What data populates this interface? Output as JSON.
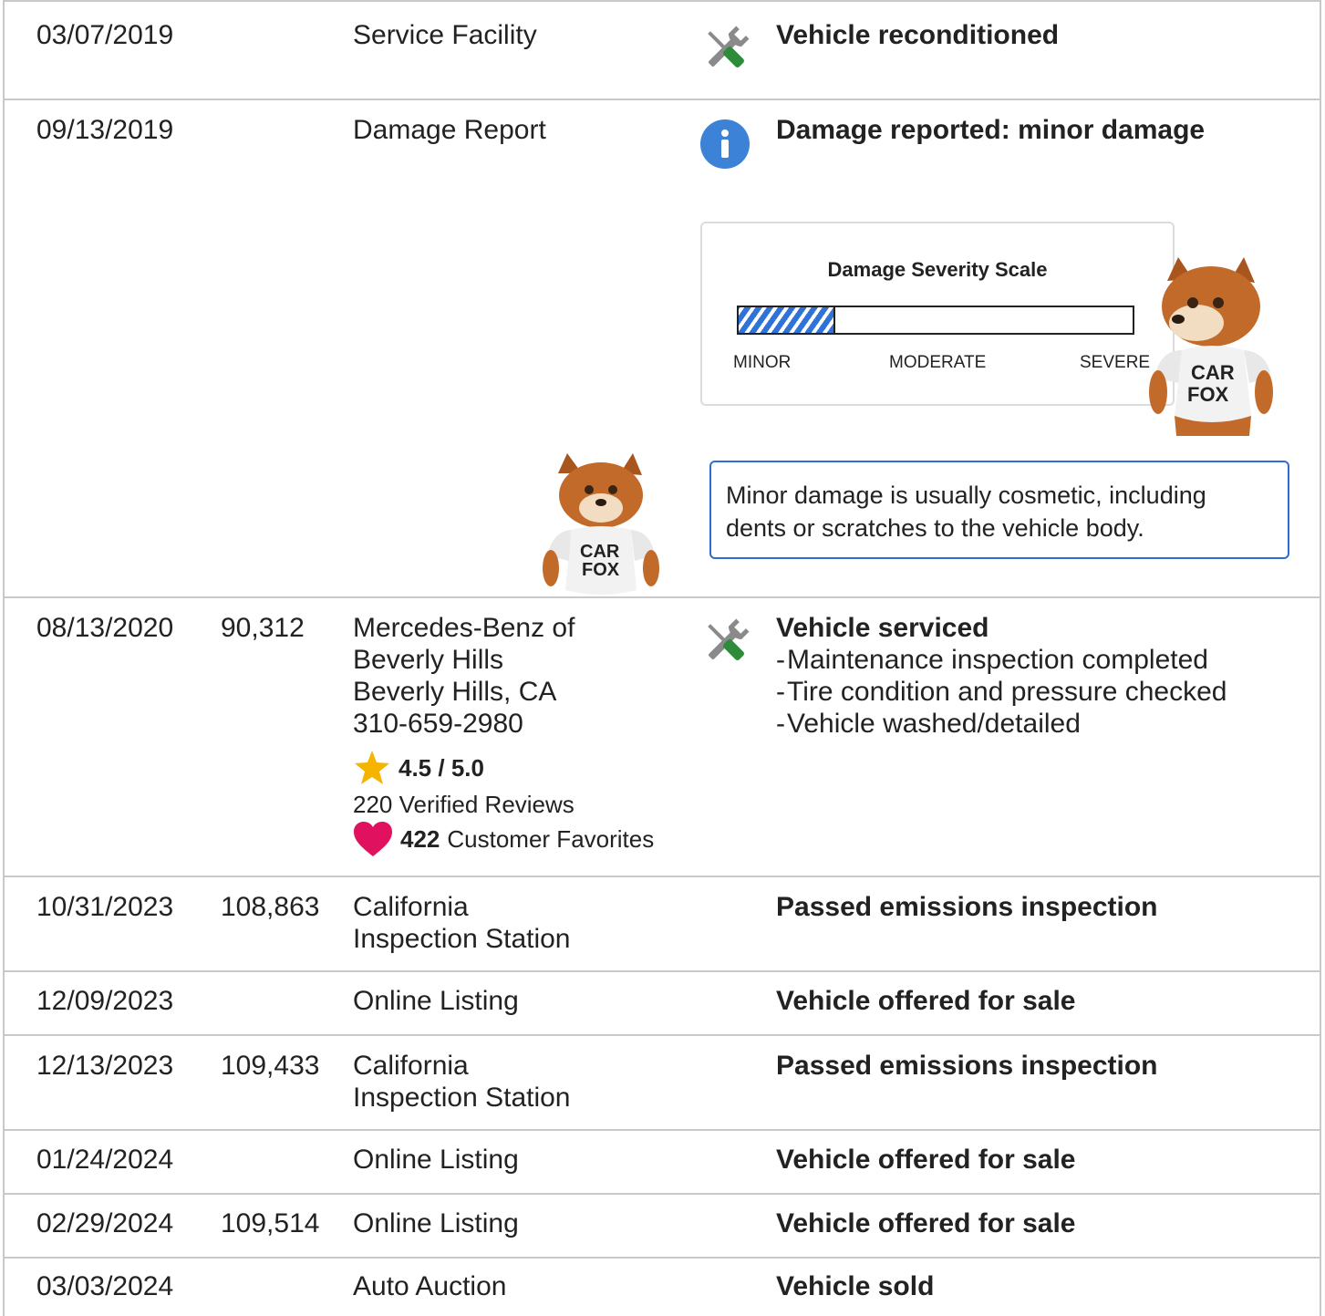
{
  "records": [
    {
      "date": "03/07/2019",
      "odometer": "",
      "source": [
        "Service Facility"
      ],
      "icon": "wrench-screwdriver-icon",
      "title": "Vehicle reconditioned",
      "details": []
    },
    {
      "date": "09/13/2019",
      "odometer": "",
      "source": [
        "Damage Report"
      ],
      "icon": "info-icon",
      "title": "Damage reported: minor damage",
      "details": []
    },
    {
      "date": "08/13/2020",
      "odometer": "90,312",
      "source": [
        "Mercedes-Benz of",
        "Beverly Hills",
        "Beverly Hills, CA",
        "310-659-2980"
      ],
      "icon": "wrench-screwdriver-icon",
      "title": "Vehicle serviced",
      "details": [
        "Maintenance inspection completed",
        "Tire condition and pressure checked",
        "Vehicle washed/detailed"
      ]
    },
    {
      "date": "10/31/2023",
      "odometer": "108,863",
      "source": [
        "California",
        "Inspection Station"
      ],
      "icon": "",
      "title": "Passed emissions inspection",
      "details": []
    },
    {
      "date": "12/09/2023",
      "odometer": "",
      "source": [
        "Online Listing"
      ],
      "icon": "",
      "title": "Vehicle offered for sale",
      "details": []
    },
    {
      "date": "12/13/2023",
      "odometer": "109,433",
      "source": [
        "California",
        "Inspection Station"
      ],
      "icon": "",
      "title": "Passed emissions inspection",
      "details": []
    },
    {
      "date": "01/24/2024",
      "odometer": "",
      "source": [
        "Online Listing"
      ],
      "icon": "",
      "title": "Vehicle offered for sale",
      "details": []
    },
    {
      "date": "02/29/2024",
      "odometer": "109,514",
      "source": [
        "Online Listing"
      ],
      "icon": "",
      "title": "Vehicle offered for sale",
      "details": []
    },
    {
      "date": "03/03/2024",
      "odometer": "",
      "source": [
        "Auto Auction"
      ],
      "icon": "",
      "title": "Vehicle sold",
      "details": []
    }
  ],
  "damage_scale": {
    "title": "Damage Severity Scale",
    "labels": [
      "MINOR",
      "MODERATE",
      "SEVERE"
    ],
    "level_fraction": 0.24,
    "fill_color": "#2f72d8",
    "note": "Minor damage is usually cosmetic, including dents or scratches to the vehicle body."
  },
  "dealer_rating": {
    "score": "4.5 / 5.0",
    "reviews": "220 Verified Reviews",
    "favorites_count": "422",
    "favorites_label": "Customer Favorites",
    "star_color": "#f4b400",
    "heart_color": "#e0125f"
  },
  "mascot": {
    "shirt_text": [
      "CAR",
      "FOX"
    ]
  },
  "colors": {
    "border": "#c9c9c9",
    "wrench": "#8a8a8a",
    "screwdriver": "#2e8b3a",
    "info": "#3c82d6",
    "note_border": "#2d6fd1"
  }
}
